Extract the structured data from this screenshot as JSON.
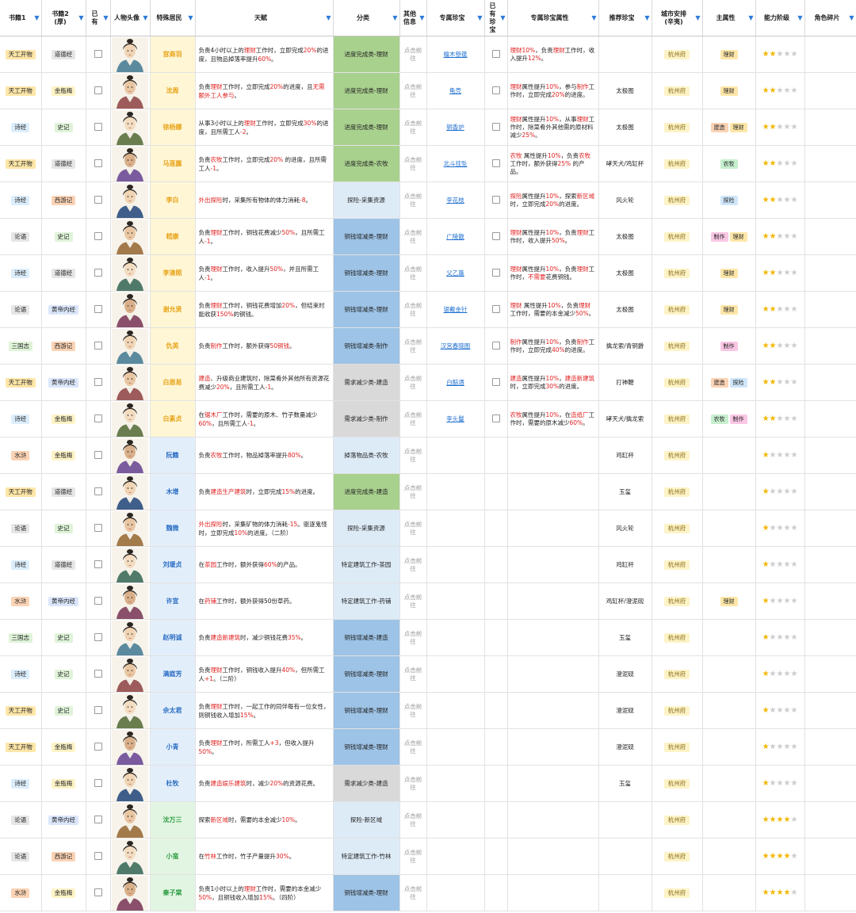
{
  "headers": [
    {
      "label": "书籍1",
      "filter": true
    },
    {
      "label": "书籍2\n(厚)",
      "filter": true
    },
    {
      "label": "已\n有",
      "filter": true
    },
    {
      "label": "人物头像",
      "filter": true
    },
    {
      "label": "特殊居民",
      "filter": true
    },
    {
      "label": "天赋",
      "filter": true
    },
    {
      "label": "分类",
      "filter": true
    },
    {
      "label": "其他信息",
      "filter": true
    },
    {
      "label": "专属珍宝",
      "filter": true
    },
    {
      "label": "已\n有\n珍\n宝",
      "filter": true
    },
    {
      "label": "专属珍宝属性",
      "filter": true
    },
    {
      "label": "推荐珍宝",
      "filter": true
    },
    {
      "label": "城市安排\n(辛夷)",
      "filter": true
    },
    {
      "label": "主属性",
      "filter": true
    },
    {
      "label": "能力阶级",
      "filter": true
    },
    {
      "label": "角色碎片",
      "filter": true
    }
  ],
  "colors": {
    "book": {
      "天工开物": "#fde6a8",
      "诗经": "#dceefc",
      "论语": "#e6e6e6",
      "三国志": "#dff3d8",
      "水浒": "#fbd3b5"
    },
    "book2": {
      "道德经": "#e6e6e6",
      "金瓶梅": "#fdf3c6",
      "史记": "#dff3d8",
      "西游记": "#fbd3b5",
      "黄帝内经": "#dbe6fb"
    },
    "cat": {
      "green": "#a9d18e",
      "blue": "#9dc3e6",
      "lightblue": "#ddebf7",
      "gray": "#d9d9d9"
    },
    "attr": {
      "理财": "#fde6a8",
      "建造": "#fbd3b5",
      "农牧": "#c6efce",
      "探险": "#cfe6fb",
      "制作": "#f9c6e4"
    },
    "name": {
      "yellow": "#fff6d5",
      "blue": "#e3eefb",
      "green": "#e2f5e2"
    }
  },
  "rows": [
    {
      "book1": "天工开物",
      "book2": "道德经",
      "name": "宫商羽",
      "nameColor": "yellow",
      "talent": "负责4小时以上的理财工作时，立即完成20%的进度，且物品掉落率提升60%。",
      "cat": "进度完成类-理财",
      "catColor": "green",
      "link": "点击前往",
      "treasure": "檀木箜篌",
      "tattr": "理财10%，负责理财工作时，收入提升12%。",
      "rec": "",
      "city": "杭州府",
      "attrs": [
        "理财"
      ],
      "stars": 2
    },
    {
      "book1": "天工开物",
      "book2": "金瓶梅",
      "name": "沈周",
      "nameColor": "yellow",
      "talent": "负责理财工作时，立即完成20%的进度，且无需额外工人参与。",
      "cat": "进度完成类-理财",
      "catColor": "green",
      "link": "点击前往",
      "treasure": "龟壳",
      "tattr": "理财属性提升10%，参与制作工作时，立即完成20%的进度。",
      "rec": "太极图",
      "city": "杭州府",
      "attrs": [
        "理财"
      ],
      "stars": 2
    },
    {
      "book1": "诗经",
      "book2": "史记",
      "name": "徐杨娜",
      "nameColor": "yellow",
      "talent": "从事3小时以上的理财工作时，立即完成30%的进度，且所需工人-2。",
      "cat": "进度完成类-理财",
      "catColor": "green",
      "link": "点击前往",
      "treasure": "铜香炉",
      "tattr": "理财属性提升10%，从事理财工作时，除菜肴外其他需的原材料减少25%。",
      "rec": "太极图",
      "city": "杭州府",
      "attrs": [
        "建造",
        "理财"
      ],
      "stars": 2
    },
    {
      "book1": "天工开物",
      "book2": "道德经",
      "name": "马莲露",
      "nameColor": "yellow",
      "talent": "负责农牧工作时，立即完成20% 的进度，且所需工人-1。",
      "cat": "进度完成类-农牧",
      "catColor": "green",
      "link": "点击前往",
      "treasure": "北斗挂坠",
      "tattr": "农牧 属性提升10%，负责农牧 工作时，额外获得25% 的产品。",
      "rec": "哮天犬/鸡缸杯",
      "city": "杭州府",
      "attrs": [
        "农牧"
      ],
      "stars": 2
    },
    {
      "book1": "诗经",
      "book2": "西游记",
      "name": "李白",
      "nameColor": "yellow",
      "talent": "外出探险时，采集所有物体的体力消耗-8。",
      "cat": "探险-采集资源",
      "catColor": "lightblue",
      "link": "点击前往",
      "treasure": "李花枝",
      "tattr": "探险属性提升10%，探索新区域时，立即完成20%的进度。",
      "rec": "风火轮",
      "city": "杭州府",
      "attrs": [
        "探险"
      ],
      "stars": 2
    },
    {
      "book1": "论语",
      "book2": "史记",
      "name": "嵇康",
      "nameColor": "yellow",
      "talent": "负责理财工作时，铜钱花费减少50%，且所需工人-1。",
      "cat": "铜钱增减类-理财",
      "catColor": "blue",
      "link": "点击前往",
      "treasure": "广陵散",
      "tattr": "理财属性提升10%，负责理财工作时，收入提升50%。",
      "rec": "太极图",
      "city": "杭州府",
      "attrs": [
        "制作",
        "理财"
      ],
      "stars": 2
    },
    {
      "book1": "诗经",
      "book2": "道德经",
      "name": "李清照",
      "nameColor": "yellow",
      "talent": "负责理财工作时，收入提升50%，并且所需工人-1。",
      "cat": "铜钱增减类-理财",
      "catColor": "blue",
      "link": "点击前往",
      "treasure": "父乙簋",
      "tattr": "理财属性提升10%，负责理财工作时，不需要花费铜钱。",
      "rec": "太极图",
      "city": "杭州府",
      "attrs": [
        "理财"
      ],
      "stars": 2
    },
    {
      "book1": "论语",
      "book2": "黄帝内经",
      "name": "谢允贤",
      "nameColor": "yellow",
      "talent": "负责理财工作时，铜钱花费增加20%，但结束时能收获150%的铜钱。",
      "cat": "铜钱增减类-理财",
      "catColor": "blue",
      "link": "点击前往",
      "treasure": "银戴金针",
      "tattr": "理财 属性提升10%，负责理财 工作时，需要的本金减少50%。",
      "rec": "太极图",
      "city": "杭州府",
      "attrs": [
        "理财"
      ],
      "stars": 2
    },
    {
      "book1": "三国志",
      "book2": "西游记",
      "name": "仇英",
      "nameColor": "yellow",
      "talent": "负责制作工作时，额外获得50铜钱。",
      "cat": "铜钱增减类-制作",
      "catColor": "blue",
      "link": "点击前往",
      "treasure": "汉宫春晓图",
      "tattr": "制作属性提升10%，负责制作工作时，立即完成40%的进度。",
      "rec": "擒龙索/青铜爵",
      "city": "杭州府",
      "attrs": [
        "制作"
      ],
      "stars": 2
    },
    {
      "book1": "天工开物",
      "book2": "黄帝内经",
      "name": "白居易",
      "nameColor": "yellow",
      "talent": "建造、升级商业建筑时，除菜肴外其他所有资源花费减少20%，且所需工人-1。",
      "cat": "需求减少类-建造",
      "catColor": "gray",
      "link": "点击前往",
      "treasure": "白醅酒",
      "tattr": "建造属性提升10%，建造新建筑时，立即完成30%的进度。",
      "rec": "打神鞭",
      "city": "杭州府",
      "attrs": [
        "建造",
        "探险"
      ],
      "stars": 2
    },
    {
      "book1": "诗经",
      "book2": "金瓶梅",
      "name": "白素贞",
      "nameColor": "yellow",
      "talent": "在锯木厂工作时，需要的原木、竹子数量减少60%，且所需工人-1。",
      "cat": "需求减少类-制作",
      "catColor": "gray",
      "link": "点击前往",
      "treasure": "李头鬘",
      "tattr": "农牧属性提升10%，在造纸厂工作时，需要的原木减少60%。",
      "rec": "哮天犬/擒龙索",
      "city": "杭州府",
      "attrs": [
        "农牧",
        "制作"
      ],
      "stars": 2
    },
    {
      "book1": "水浒",
      "book2": "金瓶梅",
      "name": "阮籍",
      "nameColor": "blue",
      "talent": "负责农牧工作时，物品掉落率提升80%。",
      "cat": "掉落物品类-农牧",
      "catColor": "lightblue",
      "link": "点击前往",
      "treasure": "",
      "tattr": "",
      "rec": "鸡缸杯",
      "city": "杭州府",
      "attrs": [],
      "stars": 1
    },
    {
      "book1": "天工开物",
      "book2": "道德经",
      "name": "木增",
      "nameColor": "blue",
      "talent": "负责建造生产建筑时，立即完成15%的进度。",
      "cat": "进度完成类-建造",
      "catColor": "green",
      "link": "点击前往",
      "treasure": "",
      "tattr": "",
      "rec": "玉玺",
      "city": "杭州府",
      "attrs": [],
      "stars": 1
    },
    {
      "book1": "论语",
      "book2": "史记",
      "name": "魏微",
      "nameColor": "blue",
      "talent": "外出探险时，采集矿物的体力消耗-15。驱逐鬼怪时，立即完成10%的进度。（二阶）",
      "cat": "探险-采集资源",
      "catColor": "lightblue",
      "link": "点击前往",
      "treasure": "",
      "tattr": "",
      "rec": "风火轮",
      "city": "杭州府",
      "attrs": [],
      "stars": 1
    },
    {
      "book1": "诗经",
      "book2": "道德经",
      "name": "刘瑗贞",
      "nameColor": "blue",
      "talent": "在茶园工作时，额外获得60%的产品。",
      "cat": "特定建筑工作-茶园",
      "catColor": "lightblue",
      "link": "点击前往",
      "treasure": "",
      "tattr": "",
      "rec": "鸡缸杯",
      "city": "杭州府",
      "attrs": [],
      "stars": 1
    },
    {
      "book1": "水浒",
      "book2": "黄帝内经",
      "name": "许宣",
      "nameColor": "blue",
      "talent": "在药铺工作时，额外获得50份草药。",
      "cat": "特定建筑工作-药铺",
      "catColor": "lightblue",
      "link": "点击前往",
      "treasure": "",
      "tattr": "",
      "rec": "鸡缸杯/澄泥砚",
      "city": "杭州府",
      "attrs": [
        "理财"
      ],
      "stars": 1
    },
    {
      "book1": "三国志",
      "book2": "史记",
      "name": "赵明诚",
      "nameColor": "blue",
      "talent": "负责建造新建筑时，减少铜钱花费35%。",
      "cat": "铜钱增减类-建造",
      "catColor": "blue",
      "link": "点击前往",
      "treasure": "",
      "tattr": "",
      "rec": "玉玺",
      "city": "杭州府",
      "attrs": [],
      "stars": 1
    },
    {
      "book1": "诗经",
      "book2": "史记",
      "name": "满庭芳",
      "nameColor": "blue",
      "talent": "负责理财工作时，铜钱收入提升40%，但所需工人+1。（二阶）",
      "cat": "铜钱增减类-理财",
      "catColor": "blue",
      "link": "点击前往",
      "treasure": "",
      "tattr": "",
      "rec": "澄泥砚",
      "city": "杭州府",
      "attrs": [],
      "stars": 1
    },
    {
      "book1": "天工开物",
      "book2": "史记",
      "name": "佘太君",
      "nameColor": "blue",
      "talent": "负责理财工作时，一起工作的同伴每有一位女性，则铜钱收入增加15%。",
      "cat": "铜钱增减类-理财",
      "catColor": "blue",
      "link": "点击前往",
      "treasure": "",
      "tattr": "",
      "rec": "澄泥砚",
      "city": "杭州府",
      "attrs": [],
      "stars": 1
    },
    {
      "book1": "天工开物",
      "book2": "金瓶梅",
      "name": "小青",
      "nameColor": "blue",
      "talent": "负责理财工作时，所需工人+3，但收入提升50%。",
      "cat": "铜钱增减类-理财",
      "catColor": "blue",
      "link": "点击前往",
      "treasure": "",
      "tattr": "",
      "rec": "澄泥砚",
      "city": "杭州府",
      "attrs": [],
      "stars": 1
    },
    {
      "book1": "诗经",
      "book2": "金瓶梅",
      "name": "杜牧",
      "nameColor": "blue",
      "talent": "负责建造娱乐建筑时，减少20%的资源花费。",
      "cat": "需求减少类-建造",
      "catColor": "gray",
      "link": "点击前往",
      "treasure": "",
      "tattr": "",
      "rec": "玉玺",
      "city": "杭州府",
      "attrs": [],
      "stars": 1
    },
    {
      "book1": "论语",
      "book2": "黄帝内经",
      "name": "沈万三",
      "nameColor": "green",
      "talent": "探索新区域时，需要的本金减少10%。",
      "cat": "探险-新区域",
      "catColor": "lightblue",
      "link": "点击前往",
      "treasure": "",
      "tattr": "",
      "rec": "",
      "city": "杭州府",
      "attrs": [],
      "stars": 4
    },
    {
      "book1": "论语",
      "book2": "西游记",
      "name": "小蛮",
      "nameColor": "green",
      "talent": "在竹林工作时，竹子产量提升30%。",
      "cat": "特定建筑工作-竹林",
      "catColor": "lightblue",
      "link": "点击前往",
      "treasure": "",
      "tattr": "",
      "rec": "",
      "city": "杭州府",
      "attrs": [],
      "stars": 4
    },
    {
      "book1": "水浒",
      "book2": "金瓶梅",
      "name": "秦子棠",
      "nameColor": "green",
      "talent": "负责1小时以上的理财工作时，需要的本金减少50%，且铜钱收入增加15%。（四阶）",
      "cat": "铜钱增减类-理财",
      "catColor": "blue",
      "link": "点击前往",
      "treasure": "",
      "tattr": "",
      "rec": "",
      "city": "杭州府",
      "attrs": [],
      "stars": 4
    }
  ]
}
